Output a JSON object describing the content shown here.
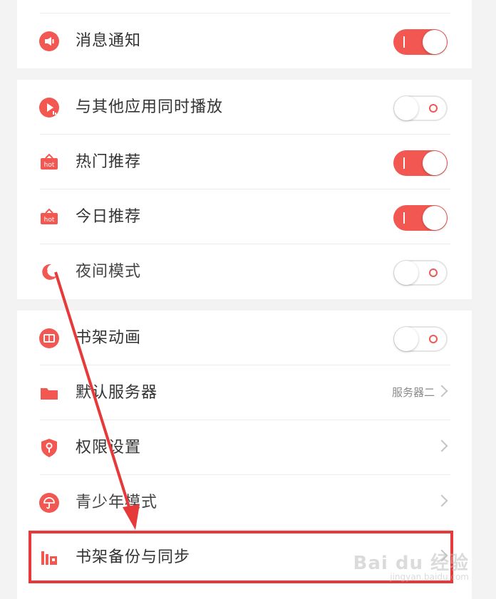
{
  "settings": {
    "group1": [
      {
        "label": "消息通知",
        "icon": "megaphone-icon",
        "toggle": true
      }
    ],
    "group2": [
      {
        "label": "与其他应用同时播放",
        "icon": "play-icon",
        "toggle": false
      },
      {
        "label": "热门推荐",
        "icon": "hot-icon",
        "toggle": true
      },
      {
        "label": "今日推荐",
        "icon": "hot-icon",
        "toggle": true
      },
      {
        "label": "夜间模式",
        "icon": "moon-icon",
        "toggle": false
      }
    ],
    "group3": [
      {
        "label": "书架动画",
        "icon": "book-icon",
        "toggle": false
      },
      {
        "label": "默认服务器",
        "icon": "folder-icon",
        "value": "服务器二"
      },
      {
        "label": "权限设置",
        "icon": "shield-key-icon"
      },
      {
        "label": "青少年模式",
        "icon": "umbrella-icon"
      },
      {
        "label": "书架备份与同步",
        "icon": "backup-icon"
      }
    ]
  },
  "watermark": {
    "main": "Bai du 经验",
    "sub": "jingyan.baidu.com"
  },
  "colors": {
    "accent": "#f25751",
    "highlight": "#e63a3a"
  }
}
